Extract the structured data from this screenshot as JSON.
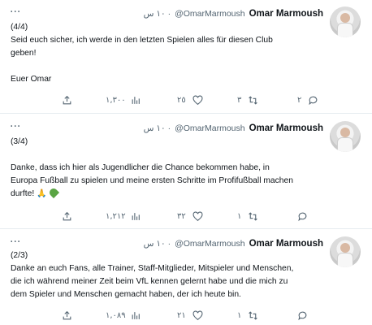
{
  "tweets": [
    {
      "name": "Omar Marmoush",
      "handle": "@OmarMarmoush",
      "time": "١٠ س ·",
      "more": "···",
      "lines": [
        "(4/4)",
        "Seid euch sicher, ich werde in den letzten Spielen alles für diesen Club",
        "geben!",
        "",
        "Euer Omar"
      ],
      "replies": "٢",
      "retweets": "٣",
      "likes": "٢٥",
      "views": "١,٣٠٠"
    },
    {
      "name": "Omar Marmoush",
      "handle": "@OmarMarmoush",
      "time": "١٠ س ·",
      "more": "···",
      "lines": [
        "(3/4)",
        "",
        "Danke, dass ich hier als Jugendlicher die Chance bekommen habe, in",
        "Europa Fußball zu spielen und meine ersten Schritte im Profifußball machen",
        "durfte!"
      ],
      "replies": "١",
      "retweets": "",
      "likes": "٣٢",
      "views": "١,٢١٢"
    },
    {
      "name": "Omar Marmoush",
      "handle": "@OmarMarmoush",
      "time": "١٠ س ·",
      "more": "···",
      "lines": [
        "(2/3)",
        "Danke an euch Fans, alle Trainer, Staff-Mitglieder, Mitspieler und Menschen,",
        "die ich während meiner Zeit beim VfL kennen gelernt habe und die mich zu",
        "dem Spieler und Menschen gemacht haben, der ich heute bin."
      ],
      "replies": "١",
      "retweets": "",
      "likes": "٢١",
      "views": "١,٠٨٩"
    }
  ],
  "icons": {
    "more": "more-icon",
    "share": "share-icon",
    "views": "views-icon",
    "like": "heart-icon",
    "retweet": "retweet-icon",
    "reply": "reply-icon"
  },
  "colors": {
    "icon": "#536471",
    "text": "#0f1419",
    "divider": "#e6ecf0",
    "green_heart": "#5aa443"
  }
}
